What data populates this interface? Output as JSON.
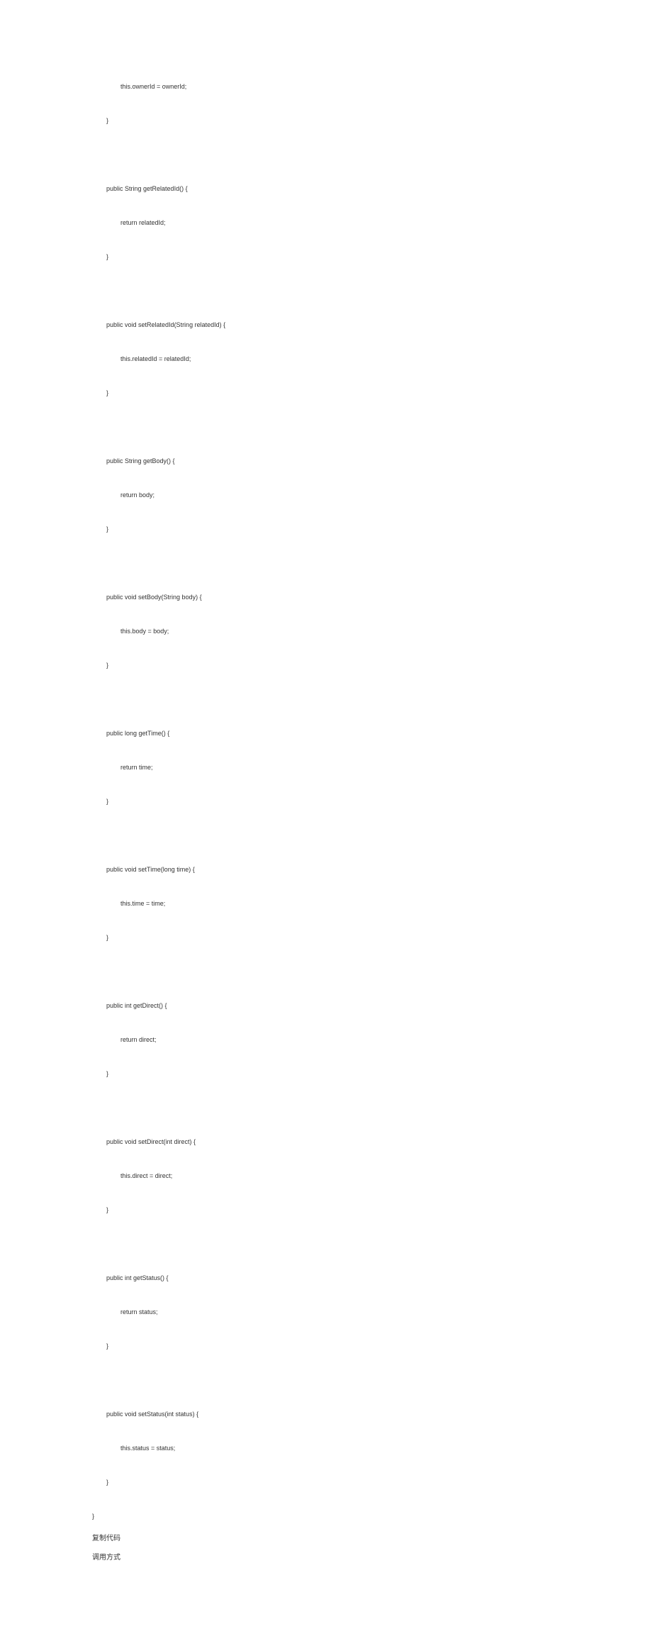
{
  "code": {
    "lines": [
      "                this.ownerId = ownerId;",
      "",
      "        }",
      "",
      "",
      "",
      "        public String getRelatedId() {",
      "",
      "                return relatedId;",
      "",
      "        }",
      "",
      "",
      "",
      "        public void setRelatedId(String relatedId) {",
      "",
      "                this.relatedId = relatedId;",
      "",
      "        }",
      "",
      "",
      "",
      "        public String getBody() {",
      "",
      "                return body;",
      "",
      "        }",
      "",
      "",
      "",
      "        public void setBody(String body) {",
      "",
      "                this.body = body;",
      "",
      "        }",
      "",
      "",
      "",
      "        public long getTime() {",
      "",
      "                return time;",
      "",
      "        }",
      "",
      "",
      "",
      "        public void setTime(long time) {",
      "",
      "                this.time = time;",
      "",
      "        }",
      "",
      "",
      "",
      "        public int getDirect() {",
      "",
      "                return direct;",
      "",
      "        }",
      "",
      "",
      "",
      "        public void setDirect(int direct) {",
      "",
      "                this.direct = direct;",
      "",
      "        }",
      "",
      "",
      "",
      "        public int getStatus() {",
      "",
      "                return status;",
      "",
      "        }",
      "",
      "",
      "",
      "        public void setStatus(int status) {",
      "",
      "                this.status = status;",
      "",
      "        }",
      "",
      "}"
    ]
  },
  "footer": {
    "copy_code": "复制代码",
    "usage": "调用方式"
  }
}
